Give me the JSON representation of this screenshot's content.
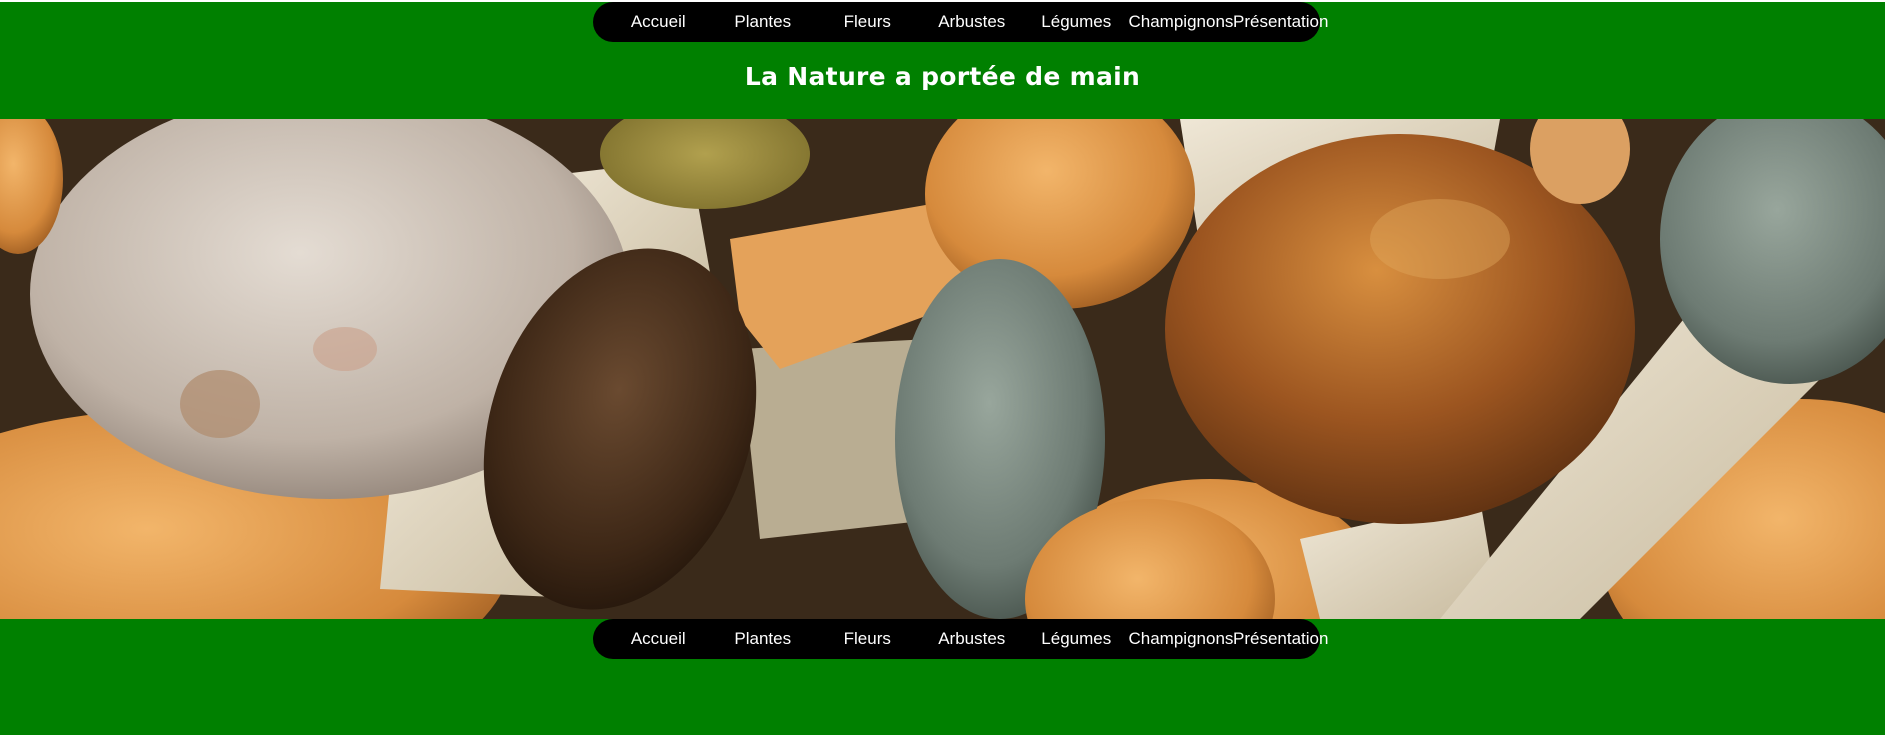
{
  "colors": {
    "page_background": "#008000",
    "nav_background": "#000000",
    "nav_text": "#ffffff",
    "title_text": "#ffffff"
  },
  "nav_top": {
    "items": [
      "Accueil",
      "Plantes",
      "Fleurs",
      "Arbustes",
      "Légumes",
      "Champignons",
      "Présentation"
    ]
  },
  "header": {
    "title": "La Nature a portée de main"
  },
  "banner": {
    "image_subject": "mushrooms"
  },
  "nav_bottom": {
    "items": [
      "Accueil",
      "Plantes",
      "Fleurs",
      "Arbustes",
      "Légumes",
      "Champignons",
      "Présentation"
    ]
  }
}
